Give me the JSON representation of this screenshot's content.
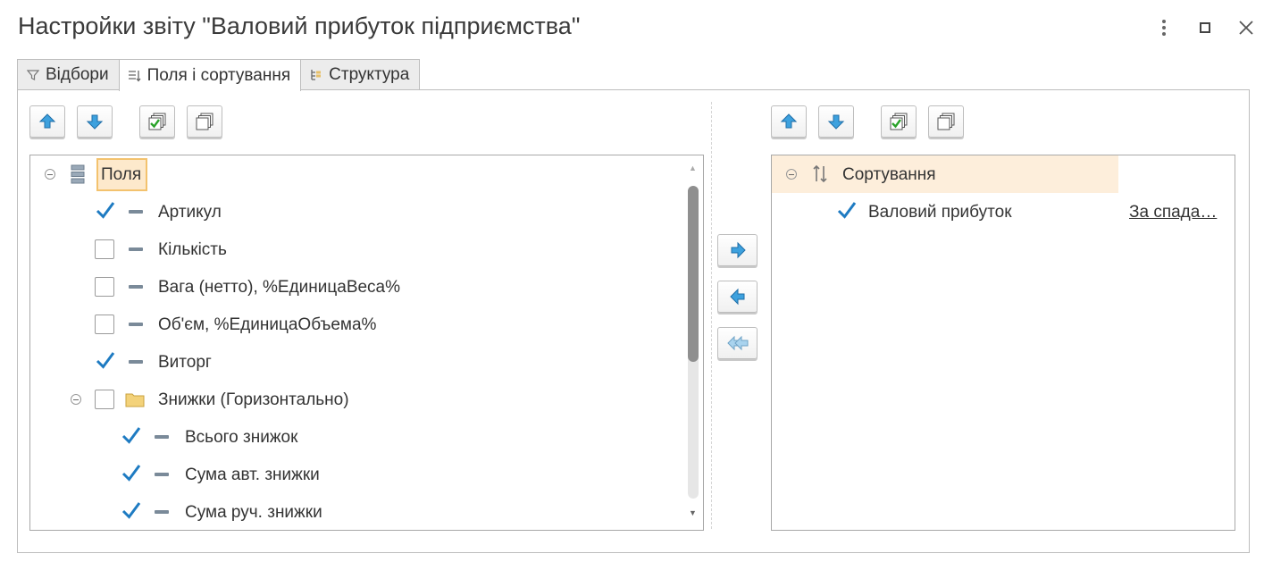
{
  "window": {
    "title": "Настройки звіту \"Валовий прибуток підприємства\""
  },
  "tabs": [
    {
      "label": "Відбори",
      "icon": "filter-icon",
      "active": false
    },
    {
      "label": "Поля і сортування",
      "icon": "fields-icon",
      "active": true
    },
    {
      "label": "Структура",
      "icon": "structure-icon",
      "active": false
    }
  ],
  "fields": {
    "root_label": "Поля",
    "items": [
      {
        "label": "Артикул",
        "checked": true
      },
      {
        "label": "Кількість",
        "checked": false
      },
      {
        "label": "Вага (нетто), %ЕдиницаВеса%",
        "checked": false
      },
      {
        "label": "Об'єм, %ЕдиницаОбъема%",
        "checked": false
      },
      {
        "label": "Виторг",
        "checked": true
      },
      {
        "label": "Знижки (Горизонтально)",
        "checked": false,
        "group": true
      },
      {
        "label": "Всього знижок",
        "checked": true
      },
      {
        "label": "Сума авт. знижки",
        "checked": true
      },
      {
        "label": "Сума руч. знижки",
        "checked": true
      }
    ]
  },
  "sorting": {
    "root_label": "Сортування",
    "items": [
      {
        "label": "Валовий прибуток",
        "checked": true,
        "direction": "За спада…"
      }
    ]
  },
  "colors": {
    "accent": "#2f8fce",
    "check": "#1e7bc2",
    "highlight": "#fde9cc"
  }
}
